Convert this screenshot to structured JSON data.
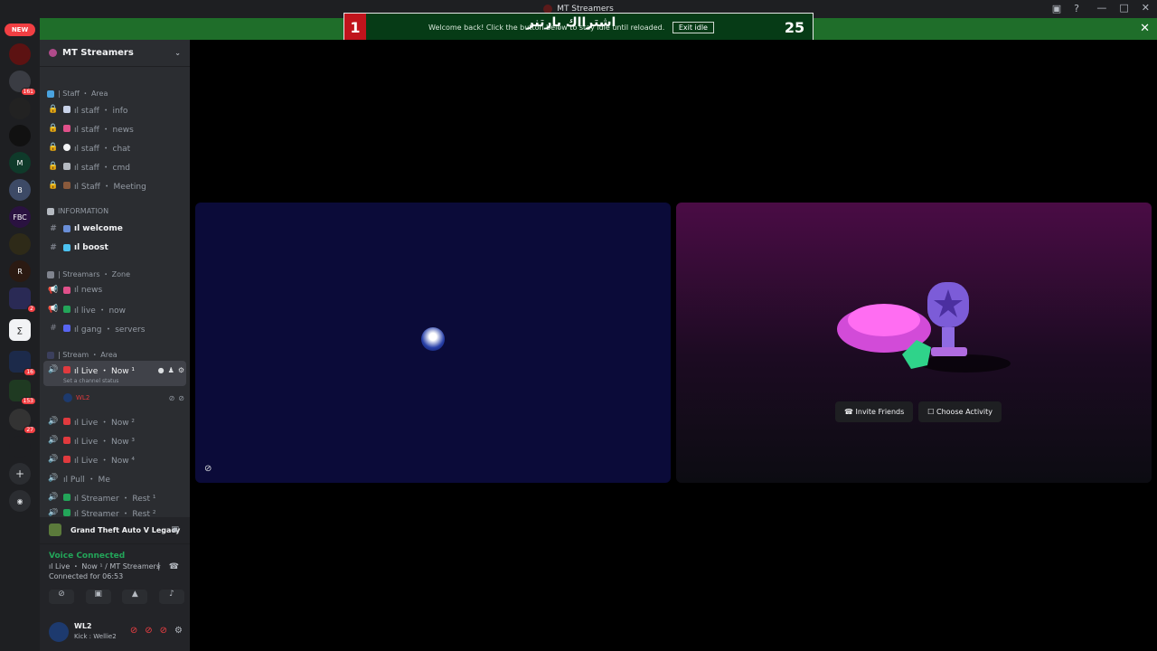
{
  "window": {
    "title": "MT Streamers",
    "controls": [
      "—",
      "□",
      "✕"
    ]
  },
  "banner": {
    "number_left": "1",
    "number_right": "25",
    "message": "Welcome back! Click the button below to stay idle until reloaded.",
    "overlay_text": "اشترااك بارتنر",
    "exit_label": "Exit idle"
  },
  "servers": {
    "new_label": "NEW",
    "badges": [
      "161",
      "2",
      "16",
      "153",
      "27"
    ],
    "labels": [
      "M",
      "B",
      "FBC",
      "R",
      "∑"
    ]
  },
  "guild": {
    "name": "MT Streamers"
  },
  "channels": {
    "staff_category": "| Staff ・ Area",
    "staff": [
      "ıl staff ・ info",
      "ıl staff ・ news",
      "ıl staff ・ chat",
      "ıl staff ・ cmd",
      "ıl Staff ・ Meeting"
    ],
    "info_category": "INFORMATION",
    "info": [
      "ıl welcome",
      "ıl boost"
    ],
    "streamers_category": "| Streamars ・ Zone",
    "streamers": [
      "ıl news",
      "ıl live ・ now",
      "ıl gang ・ servers"
    ],
    "stream_category": "| Stream ・ Area",
    "active_voice": "ıl Live ・ Now ¹",
    "active_status": "Set a channel status",
    "voice_user": "WL2",
    "voice": [
      "ıl Live ・ Now ²",
      "ıl Live ・ Now ³",
      "ıl Live ・ Now ⁴",
      "ıl Pull ・ Me",
      "ıl Streamer ・ Rest ¹",
      "ıl Streamer ・ Rest ²"
    ]
  },
  "panel": {
    "game": "Grand Theft Auto V Legacy",
    "voice_connected": "Voice Connected",
    "channel_path": "ıl Live ・ Now ¹ / MT Streamers",
    "connected_for": "Connected for 06:53"
  },
  "user": {
    "name": "WL2",
    "status": "Kick : Wellie2"
  },
  "activity": {
    "invite_label": "Invite Friends",
    "choose_label": "Choose Activity"
  },
  "colors": {
    "accent_green": "#1f6e2a",
    "danger_red": "#f23f43",
    "online_green": "#23a559"
  }
}
